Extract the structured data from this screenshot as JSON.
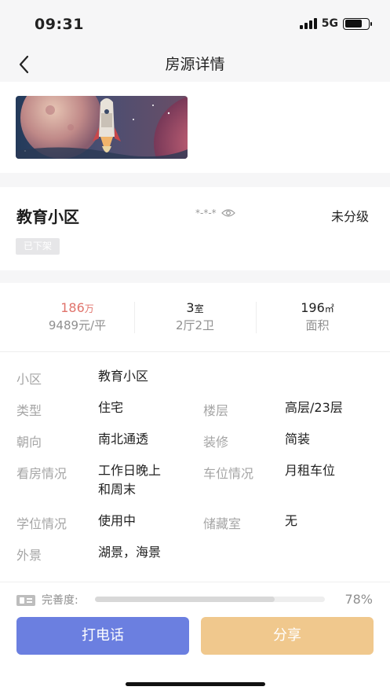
{
  "status": {
    "time": "09:31",
    "network": "5G",
    "battery_level": 0.74
  },
  "nav": {
    "title": "房源详情"
  },
  "listing": {
    "name": "教育小区",
    "masked_contact": "*-*-*",
    "grade": "未分级",
    "status_tag": "已下架"
  },
  "stats": {
    "price_value": "186",
    "price_unit": "万",
    "unit_price": "9489元/平",
    "rooms_value": "3",
    "rooms_unit": "室",
    "rooms_sub": "2厅2卫",
    "area_value": "196",
    "area_unit": "㎡",
    "area_label": "面积"
  },
  "details": {
    "community_label": "小区",
    "community_value": "教育小区",
    "type_label": "类型",
    "type_value": "住宅",
    "floor_label": "楼层",
    "floor_value": "高层/23层",
    "orientation_label": "朝向",
    "orientation_value": "南北通透",
    "decoration_label": "装修",
    "decoration_value": "简装",
    "viewing_label": "看房情况",
    "viewing_value_1": "工作日晚上",
    "viewing_value_2": "和周末",
    "parking_label": "车位情况",
    "parking_value": "月租车位",
    "school_label": "学位情况",
    "school_value": "使用中",
    "storage_label": "储藏室",
    "storage_value": "无",
    "view_label": "外景",
    "view_value": "湖景，海景"
  },
  "completeness": {
    "label": "完善度:",
    "percent_text": "78%",
    "percent": 78
  },
  "actions": {
    "call_label": "打电话",
    "share_label": "分享"
  },
  "colors": {
    "price": "#e0736b",
    "call_button": "#6b7fe0",
    "share_button": "#f0c88d"
  }
}
